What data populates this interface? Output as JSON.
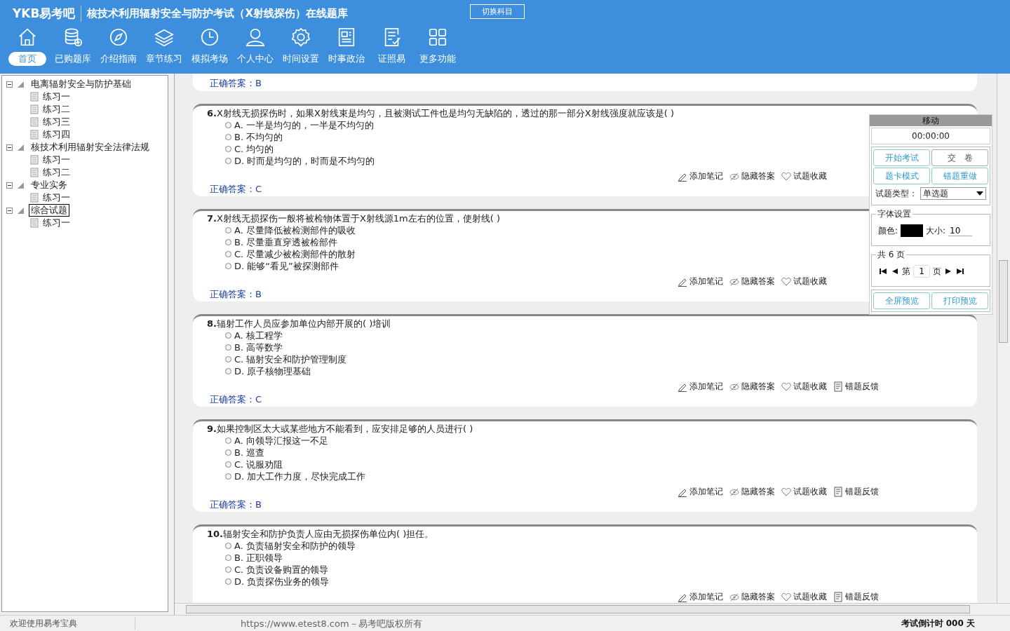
{
  "header": {
    "logo": "YKB易考吧",
    "title": "核技术利用辐射安全与防护考试（X射线探伤）在线题库",
    "switch_button": "切换科目"
  },
  "nav": [
    {
      "label": "首页",
      "selected": true
    },
    {
      "label": "已购题库",
      "selected": false
    },
    {
      "label": "介绍指南",
      "selected": false
    },
    {
      "label": "章节练习",
      "selected": false
    },
    {
      "label": "模拟考场",
      "selected": false
    },
    {
      "label": "个人中心",
      "selected": false
    },
    {
      "label": "时间设置",
      "selected": false
    },
    {
      "label": "时事政治",
      "selected": false
    },
    {
      "label": "证照易",
      "selected": false
    },
    {
      "label": "更多功能",
      "selected": false
    }
  ],
  "tree": [
    {
      "label": "电离辐射安全与防护基础",
      "expanded": true,
      "selected": false,
      "children": [
        {
          "label": "练习一",
          "selected": false
        },
        {
          "label": "练习二",
          "selected": false
        },
        {
          "label": "练习三",
          "selected": false
        },
        {
          "label": "练习四",
          "selected": false
        }
      ]
    },
    {
      "label": "核技术利用辐射安全法律法规",
      "expanded": true,
      "selected": false,
      "children": [
        {
          "label": "练习一",
          "selected": false
        },
        {
          "label": "练习二",
          "selected": false
        }
      ]
    },
    {
      "label": "专业实务",
      "expanded": true,
      "selected": false,
      "children": [
        {
          "label": "练习一",
          "selected": false
        }
      ]
    },
    {
      "label": "综合试题",
      "expanded": true,
      "selected": true,
      "children": [
        {
          "label": "练习一",
          "selected": false
        }
      ]
    }
  ],
  "questions": [
    {
      "answer_label": "正确答案：",
      "answer": "B"
    },
    {
      "number": "6.",
      "text": "X射线无损探伤时，如果X射线束是均匀，且被测试工件也是均匀无缺陷的，透过的那一部分X射线强度就应该是( )",
      "options": [
        {
          "label": "A. 一半是均匀的，一半是不均匀的",
          "selected": false
        },
        {
          "label": "B. 不均匀的",
          "selected": false
        },
        {
          "label": "C. 均匀的",
          "selected": false
        },
        {
          "label": "D. 时而是均匀的，时而是不均匀的",
          "selected": false
        }
      ],
      "actions": [
        "添加笔记",
        "隐藏答案",
        "试题收藏"
      ],
      "answer_label": "正确答案：",
      "answer": "C"
    },
    {
      "number": "7.",
      "text": "X射线无损探伤一般将被检物体置于X射线源1m左右的位置，使射线( )",
      "options": [
        {
          "label": "A. 尽量降低被检测部件的吸收",
          "selected": false
        },
        {
          "label": "B. 尽量垂直穿透被检部件",
          "selected": false
        },
        {
          "label": "C. 尽量减少被检测部件的散射",
          "selected": false
        },
        {
          "label": "D. 能够“看见”被探测部件",
          "selected": false
        }
      ],
      "actions": [
        "添加笔记",
        "隐藏答案",
        "试题收藏"
      ],
      "answer_label": "正确答案：",
      "answer": "B"
    },
    {
      "number": "8.",
      "text": "辐射工作人员应参加单位内部开展的( )培训",
      "options": [
        {
          "label": "A. 核工程学",
          "selected": false
        },
        {
          "label": "B. 高等数学",
          "selected": false
        },
        {
          "label": "C. 辐射安全和防护管理制度",
          "selected": false
        },
        {
          "label": "D. 原子核物理基础",
          "selected": false
        }
      ],
      "actions": [
        "添加笔记",
        "隐藏答案",
        "试题收藏",
        "错题反馈"
      ],
      "answer_label": "正确答案：",
      "answer": "C"
    },
    {
      "number": "9.",
      "text": "如果控制区太大或某些地方不能看到，应安排足够的人员进行( )",
      "options": [
        {
          "label": "A. 向领导汇报这一不足",
          "selected": false
        },
        {
          "label": "B. 巡查",
          "selected": false
        },
        {
          "label": "C. 说服劝阻",
          "selected": false
        },
        {
          "label": "D. 加大工作力度，尽快完成工作",
          "selected": false
        }
      ],
      "actions": [
        "添加笔记",
        "隐藏答案",
        "试题收藏",
        "错题反馈"
      ],
      "answer_label": "正确答案：",
      "answer": "B"
    },
    {
      "number": "10.",
      "text": "辐射安全和防护负责人应由无损探伤单位内( )担任。",
      "options": [
        {
          "label": "A. 负责辐射安全和防护的领导",
          "selected": false
        },
        {
          "label": "B. 正职领导",
          "selected": false
        },
        {
          "label": "C. 负责设备购置的领导",
          "selected": false
        },
        {
          "label": "D. 负责探伤业务的领导",
          "selected": false
        }
      ],
      "actions": [
        "添加笔记",
        "隐藏答案",
        "试题收藏",
        "错题反馈"
      ]
    }
  ],
  "panel": {
    "title": "移动",
    "timer": "00:00:00",
    "buttons": [
      "开始考试",
      "交　卷",
      "题卡模式",
      "错题重做"
    ],
    "type_label": "试题类型：",
    "type_value": "单选题",
    "font_legend": "字体设置",
    "color_label": "颜色:",
    "size_label": "大小:",
    "size_value": "10",
    "pages_legend": "共 6 页",
    "page_prefix": "第",
    "page_value": "1",
    "page_suffix": "页",
    "bottom_buttons": [
      "全屏预览",
      "打印预览"
    ]
  },
  "status_bar": {
    "welcome": "欢迎使用易考宝典",
    "copyright": "https://www.etest8.com－易考吧版权所有",
    "countdown": "考试倒计时 000 天"
  }
}
